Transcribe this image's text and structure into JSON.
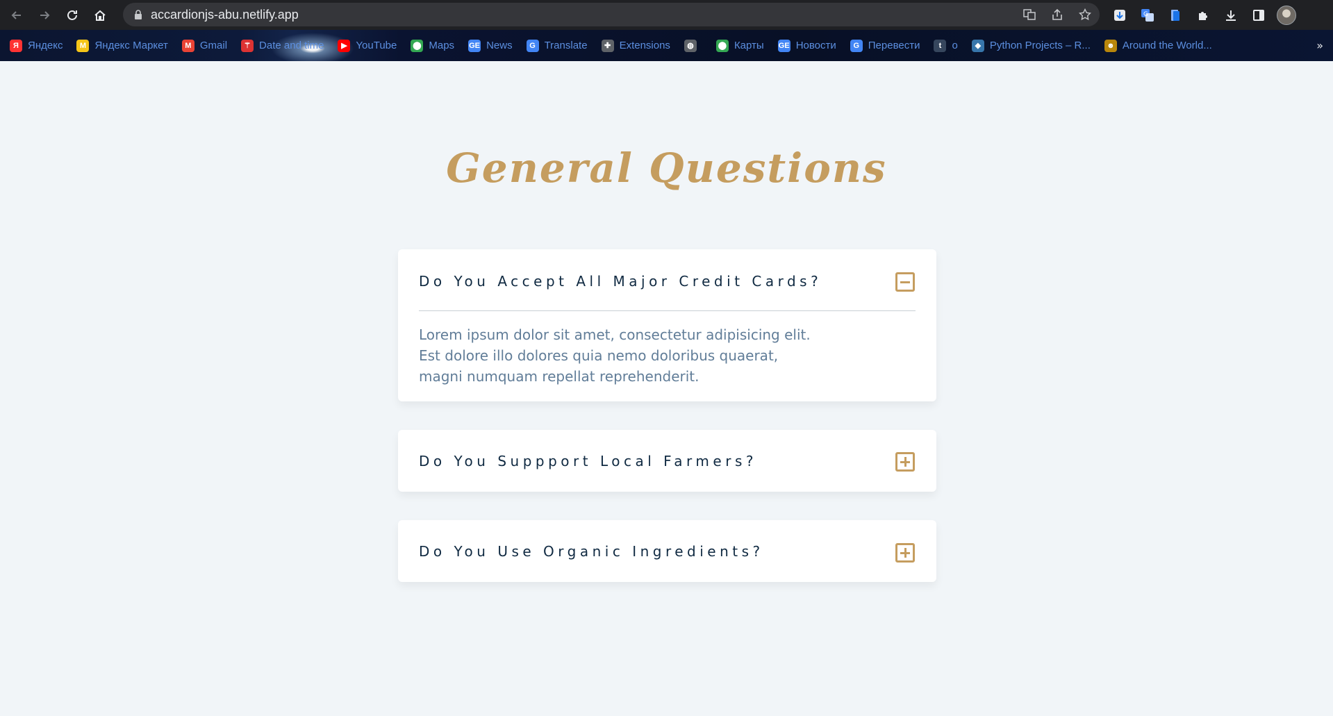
{
  "browser": {
    "url": "accardionjs-abu.netlify.app",
    "bookmarks": [
      {
        "label": "Яндекс",
        "icon": "yandex-icon",
        "color": "#ff3333",
        "glyph": "Я"
      },
      {
        "label": "Яндекс Маркет",
        "icon": "yandex-market-icon",
        "color": "#f5c518",
        "glyph": "M"
      },
      {
        "label": "Gmail",
        "icon": "gmail-icon",
        "color": "#ea4335",
        "glyph": "M"
      },
      {
        "label": "Date and time",
        "icon": "date-time-icon",
        "color": "#d33",
        "glyph": "⚚"
      },
      {
        "label": "YouTube",
        "icon": "youtube-icon",
        "color": "#ff0000",
        "glyph": "▶"
      },
      {
        "label": "Maps",
        "icon": "maps-icon",
        "color": "#34a853",
        "glyph": "⬤"
      },
      {
        "label": "News",
        "icon": "news-icon",
        "color": "#4285f4",
        "glyph": "GE"
      },
      {
        "label": "Translate",
        "icon": "translate-icon",
        "color": "#4285f4",
        "glyph": "G"
      },
      {
        "label": "Extensions",
        "icon": "extensions-icon",
        "color": "#5f6368",
        "glyph": "✚"
      },
      {
        "label": "",
        "icon": "globe-icon",
        "color": "#5f6368",
        "glyph": "◍"
      },
      {
        "label": "Карты",
        "icon": "maps-icon",
        "color": "#34a853",
        "glyph": "⬤"
      },
      {
        "label": "Новости",
        "icon": "news-icon",
        "color": "#4285f4",
        "glyph": "GE"
      },
      {
        "label": "Перевести",
        "icon": "translate-icon",
        "color": "#4285f4",
        "glyph": "G"
      },
      {
        "label": "o",
        "icon": "tumblr-icon",
        "color": "#36465d",
        "glyph": "t"
      },
      {
        "label": "Python Projects – R...",
        "icon": "python-icon",
        "color": "#3776ab",
        "glyph": "◆"
      },
      {
        "label": "Around the World...",
        "icon": "around-world-icon",
        "color": "#b8860b",
        "glyph": "☻"
      }
    ],
    "more_label": "»"
  },
  "page": {
    "title": "General Questions",
    "questions": [
      {
        "question": "Do You Accept All Major Credit Cards?",
        "answer": "Lorem ipsum dolor sit amet, consectetur adipisicing elit. Est dolore illo dolores quia nemo doloribus quaerat, magni numquam repellat reprehenderit.",
        "expanded": true
      },
      {
        "question": "Do You Suppport Local Farmers?",
        "answer": "",
        "expanded": false
      },
      {
        "question": "Do You Use Organic Ingredients?",
        "answer": "",
        "expanded": false
      }
    ]
  },
  "colors": {
    "accent": "#c59d5f",
    "question_text": "#102a42",
    "answer_text": "#617d98",
    "background": "#f1f5f8"
  }
}
